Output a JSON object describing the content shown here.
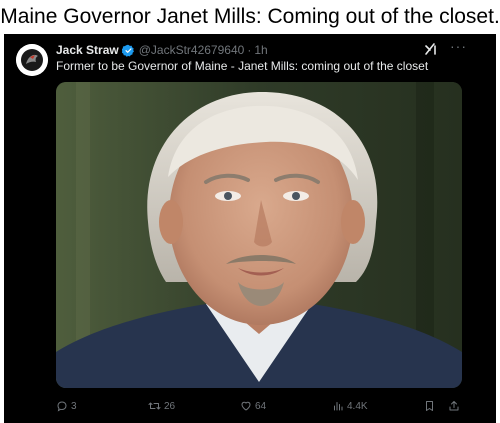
{
  "caption": "Maine Governor Janet Mills: Coming out of the closet.",
  "tweet": {
    "display_name": "Jack Straw",
    "handle": "@JackStr42679640",
    "separator": "·",
    "time": "1h",
    "text": "Former to be Governor of Maine - Janet Mills: coming out of the closet",
    "more_glyph": "···",
    "stats": {
      "replies": "3",
      "retweets": "26",
      "likes": "64",
      "views": "4.4K"
    }
  },
  "icons": {
    "verified": "verified-badge-icon",
    "grok": "grok-icon",
    "more": "more-icon",
    "reply": "reply-icon",
    "retweet": "retweet-icon",
    "like": "heart-icon",
    "views": "views-icon",
    "bookmark": "bookmark-icon",
    "share": "share-icon"
  },
  "colors": {
    "background": "#000000",
    "text": "#e7e9ea",
    "muted": "#71767b",
    "verified": "#1d9bf0"
  }
}
